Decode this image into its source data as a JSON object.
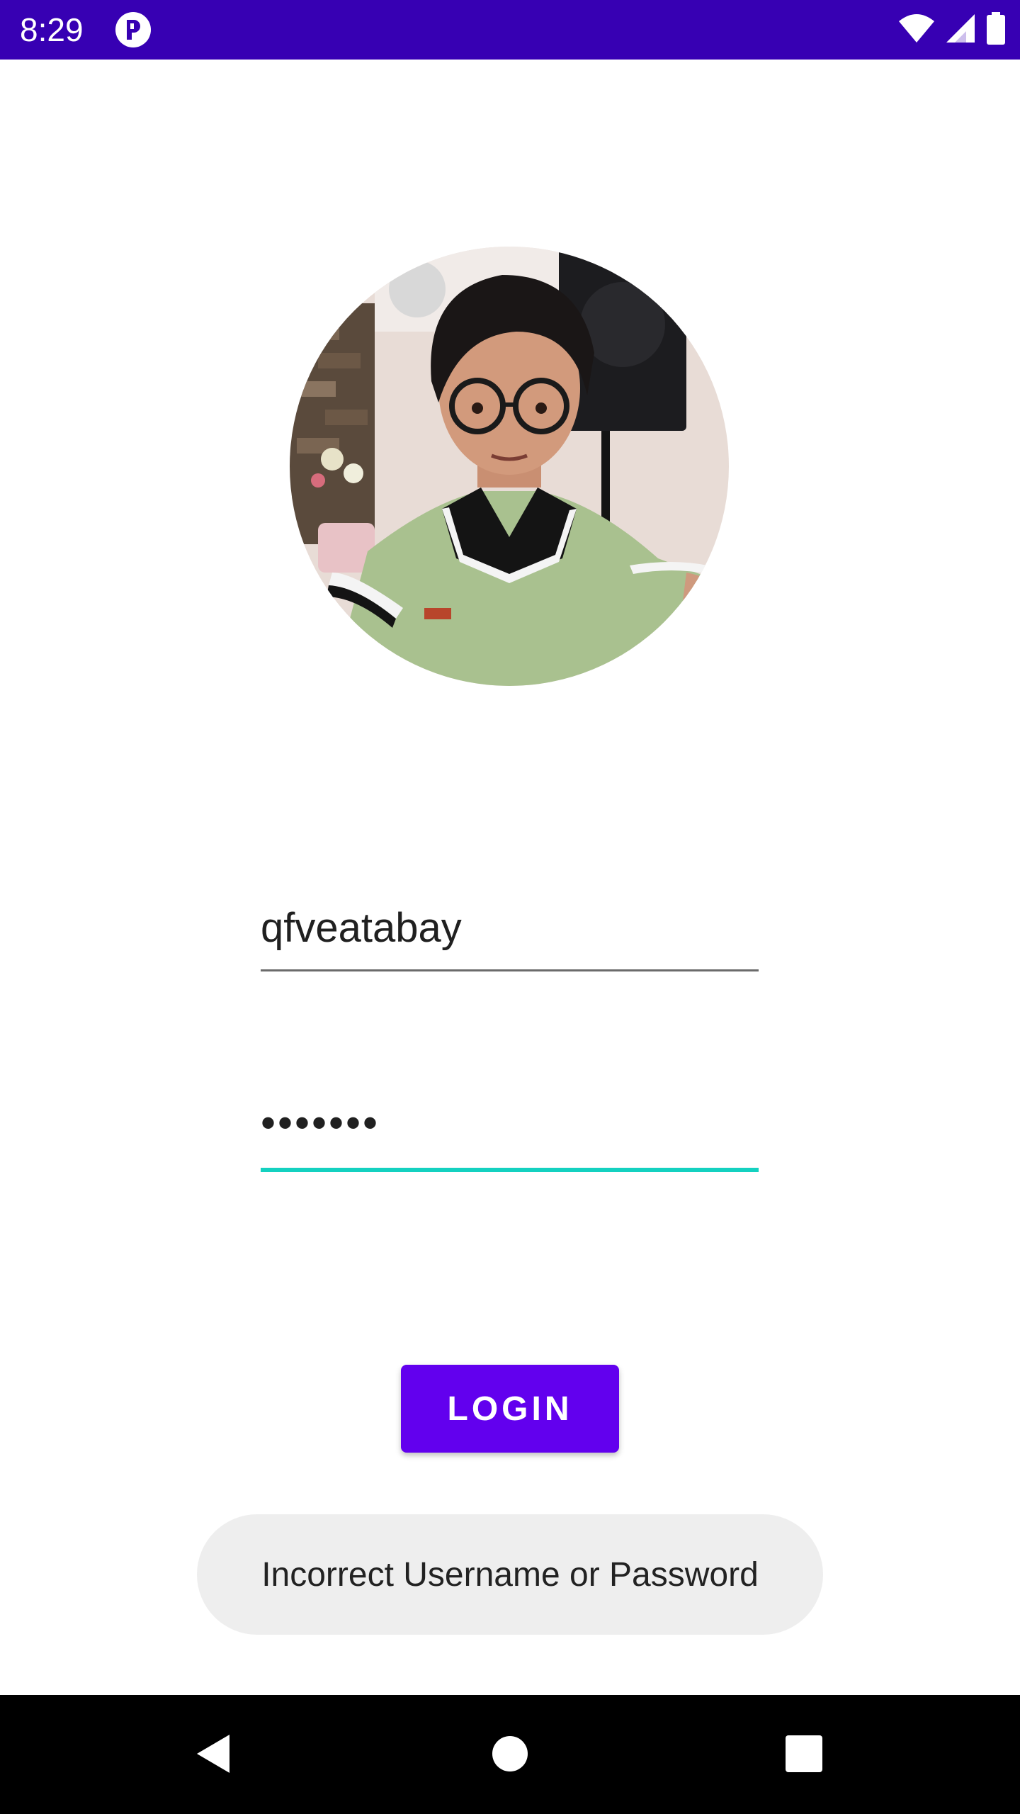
{
  "status_bar": {
    "time": "8:29",
    "background_color": "#3700b3",
    "icons": [
      "app-notification-icon",
      "wifi-icon",
      "cell-signal-icon",
      "battery-icon"
    ]
  },
  "profile": {
    "avatar": "profile-photo"
  },
  "form": {
    "username_value": "qfveatabay",
    "password_value": "•••••••",
    "accent_color": "#14d1c0"
  },
  "login_button": {
    "label": "LOGIN",
    "color": "#6200ee"
  },
  "toast": {
    "message": "Incorrect Username or Password"
  },
  "nav_bar": {
    "icons": [
      "back-icon",
      "home-icon",
      "recents-icon"
    ]
  }
}
